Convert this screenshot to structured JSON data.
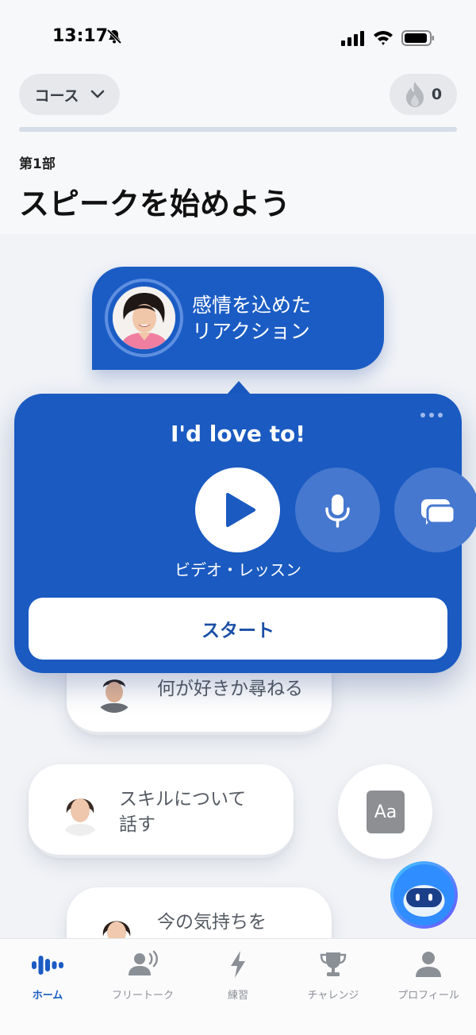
{
  "status_bar": {
    "time": "13:17"
  },
  "header": {
    "course_label": "コース",
    "streak_count": "0",
    "progress_fraction": 0.0,
    "part_label": "第1部",
    "title": "スピークを始めよう"
  },
  "lessons": {
    "active": {
      "title_line1": "感情を込めた",
      "title_line2": "リアクション"
    },
    "item2": {
      "title": "何が好きか尋ねる"
    },
    "item3": {
      "title_line1": "スキルについて",
      "title_line2": "話す"
    },
    "item4": {
      "title": "今の気持ちを"
    }
  },
  "popup": {
    "phrase": "I'd love to!",
    "video_label": "ビデオ・レッスン",
    "start_label": "スタート"
  },
  "aa_label": "Aa",
  "tabs": [
    {
      "label": "ホーム",
      "icon": "waveform-icon",
      "active": true
    },
    {
      "label": "フリートーク",
      "icon": "person-speaking-icon",
      "active": false
    },
    {
      "label": "練習",
      "icon": "lightning-icon",
      "active": false
    },
    {
      "label": "チャレンジ",
      "icon": "trophy-icon",
      "active": false
    },
    {
      "label": "プロフィール",
      "icon": "person-icon",
      "active": false
    }
  ],
  "colors": {
    "accent": "#1b5cc4",
    "popup": "#1a5ac1",
    "background": "#f1f3f7"
  }
}
